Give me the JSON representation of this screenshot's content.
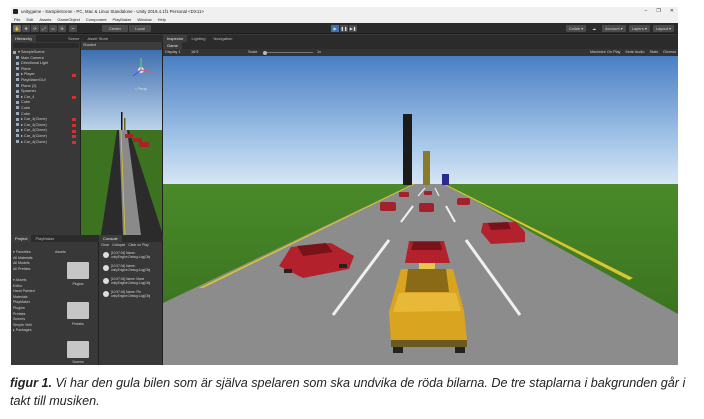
{
  "window": {
    "title": "unitygame - SampleScene - PC, Mac & Linux Standalone - Unity 2019.4.1f1 Personal <DX11>",
    "controls": [
      "–",
      "❐",
      "✕"
    ]
  },
  "menu": [
    "File",
    "Edit",
    "Assets",
    "GameObject",
    "Component",
    "PlayMaker",
    "Window",
    "Help"
  ],
  "toolbar": {
    "collab": "Collab ▾",
    "account": "Account ▾",
    "layers": "Layers ▾",
    "layout": "Layout ▾",
    "pivot": "Center",
    "space": "Local"
  },
  "hierarchy": {
    "tabs": [
      "Hierarchy",
      "Scene",
      "Asset Store",
      "Console"
    ],
    "items": [
      {
        "label": "▾ SampleScene",
        "warn": false
      },
      {
        "label": "Main Camera",
        "warn": false
      },
      {
        "label": "Directional Light",
        "warn": false
      },
      {
        "label": "Plane",
        "warn": false
      },
      {
        "label": "▸ Player",
        "warn": true
      },
      {
        "label": "PlayMakerGUI",
        "warn": false
      },
      {
        "label": "Plane (1)",
        "warn": false
      },
      {
        "label": "Spawner",
        "warn": false
      },
      {
        "label": "▸ Car_4",
        "warn": true
      },
      {
        "label": "Cube",
        "warn": false
      },
      {
        "label": "Cube",
        "warn": false
      },
      {
        "label": "Cube",
        "warn": false
      },
      {
        "label": "▸ Car_4(Clone)",
        "warn": true
      },
      {
        "label": "▸ Car_4(Clone)",
        "warn": true
      },
      {
        "label": "▸ Car_4(Clone)",
        "warn": true
      },
      {
        "label": "▸ Car_4(Clone)",
        "warn": true
      },
      {
        "label": "▸ Car_4(Clone)",
        "warn": true
      }
    ]
  },
  "scene": {
    "mode": "Shaded",
    "persp": "< Persp"
  },
  "inspector": {
    "tabs": [
      "Inspector",
      "Lighting",
      "Navigation"
    ]
  },
  "game": {
    "tab": "Game",
    "display": "Display 1",
    "aspect": "16:9",
    "scale_label": "Scale",
    "scale_value": "1x",
    "right": [
      "Maximize On Play",
      "Mute Audio",
      "Stats",
      "Gizmos"
    ]
  },
  "project": {
    "tabs": [
      "Project",
      "PlayMaker"
    ],
    "favorites": [
      "▾ Favorites",
      "All Materials",
      "All Models",
      "All Prefabs",
      "",
      "▾ Assets",
      "Editor",
      "Hand Painted",
      "Materials",
      "PlayMaker",
      "Plugins",
      "Prefabs",
      "Scenes",
      "Simple Vehi",
      "▸ Packages"
    ],
    "breadcrumb": "Assets",
    "folders": [
      "Plugins",
      "Prefabs",
      "Scenes"
    ]
  },
  "console": {
    "tabs": [
      "Console"
    ],
    "buttons": [
      "Clear",
      "Collapse",
      "Clear on Play"
    ],
    "logs": [
      "[10:57:04] Name:\nunityEngine.Debug:Log(Obj",
      "[10:57:04] Name:\nunityEngine.Debug:Log(Obj",
      "[10:57:04] Name: Mane\nunityEngine.Debug:Log(Obj",
      "[10:57:04] Name: Pin\nunityEngine.Debug:Log(Obj"
    ]
  },
  "caption": {
    "label": "figur 1.",
    "text": " Vi har den gula bilen som är själva spelaren som ska undvika de röda bilarna. De tre staplarna i bakgrunden går i takt till musiken."
  },
  "colors": {
    "sky_top": "#4a7fc4",
    "sky_bottom": "#c9dff2",
    "grass": "#3f7a22",
    "road": "#8c8c8c",
    "player_car": "#d9a520",
    "enemy_car": "#b3222c",
    "bars": [
      "#1b1b1b",
      "#8a7a2c",
      "#2a2a8a"
    ]
  },
  "icons": [
    "unity-logo-icon",
    "hand-tool-icon",
    "move-tool-icon",
    "play-icon",
    "pause-icon",
    "step-icon",
    "folder-icon",
    "info-icon"
  ]
}
